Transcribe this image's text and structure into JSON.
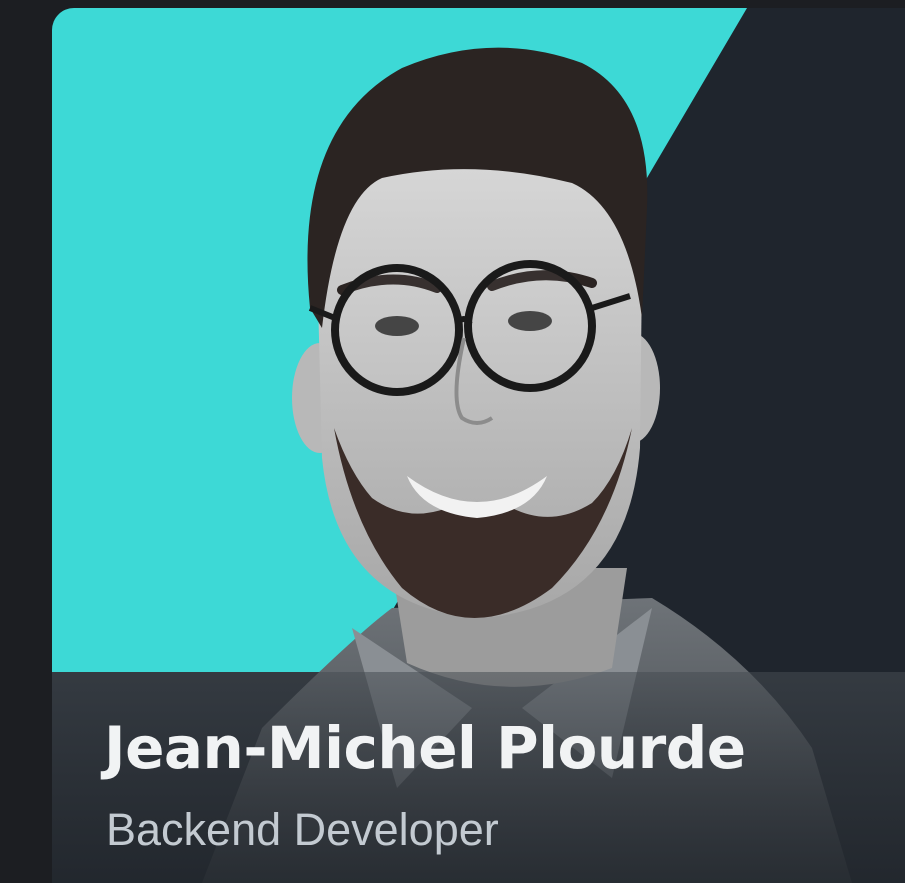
{
  "profile": {
    "name": "Jean-Michel Plourde",
    "role": "Backend Developer"
  },
  "colors": {
    "page_background": "#1c1e22",
    "card_dark": "#1f252d",
    "accent_turquoise": "#3dd9d6",
    "name_text": "#f1f3f4",
    "role_text": "#c3cad1"
  }
}
